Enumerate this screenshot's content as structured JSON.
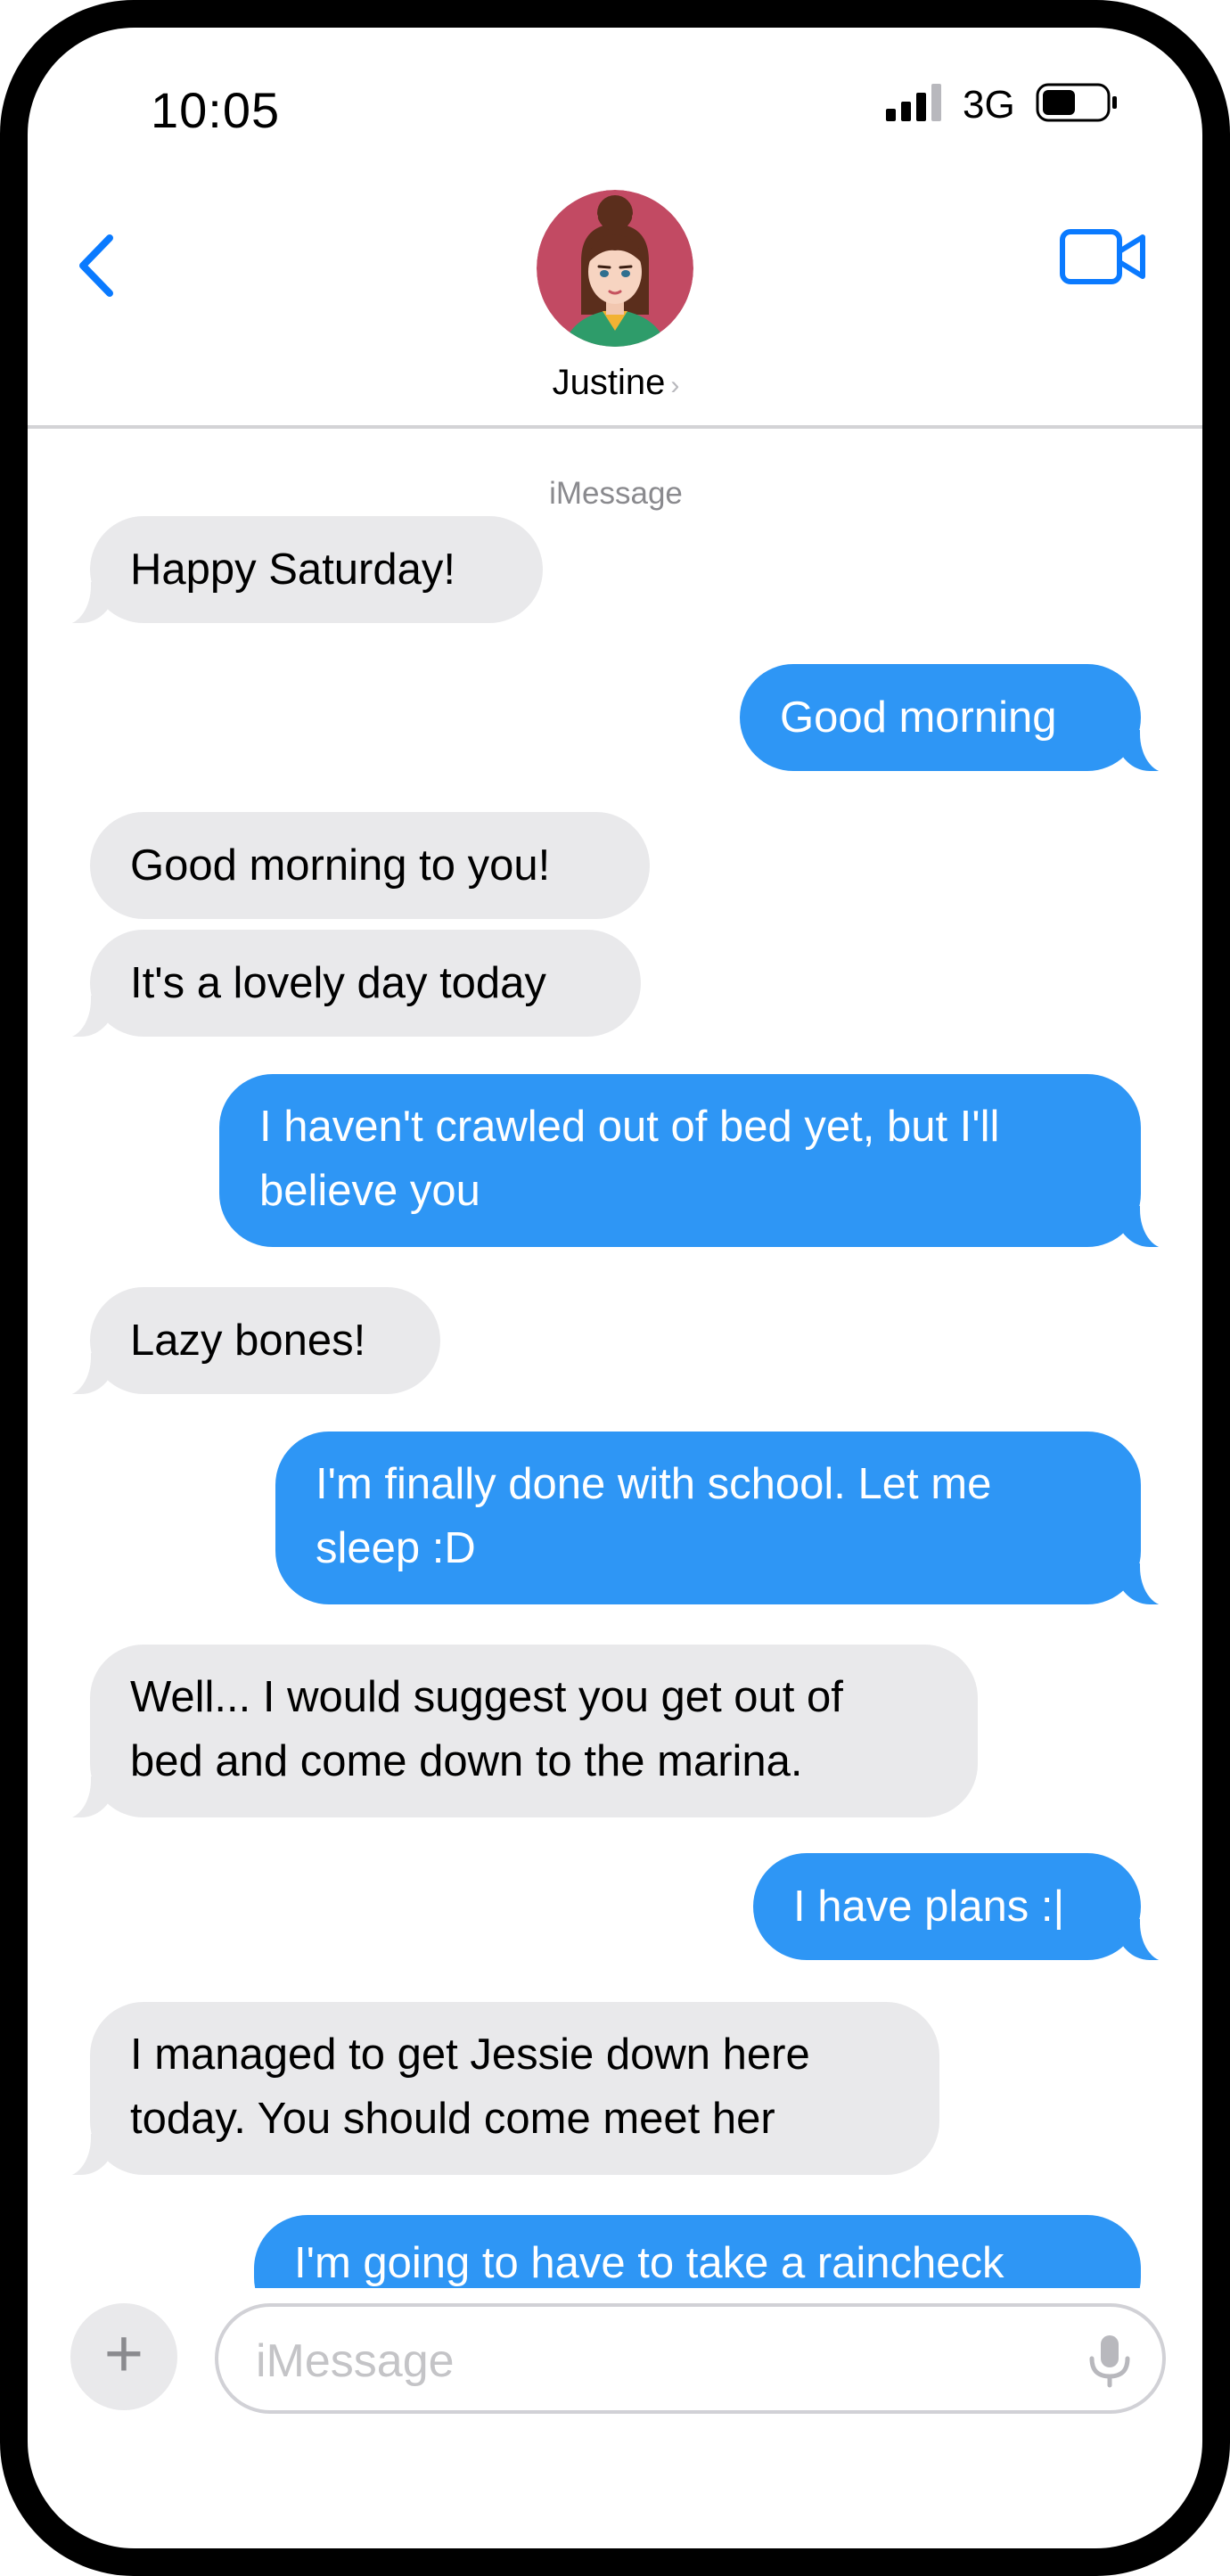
{
  "status_bar": {
    "time": "10:05",
    "network": "3G"
  },
  "header": {
    "contact_name": "Justine",
    "avatar_icon": "contact-avatar-icon",
    "back_icon": "chevron-left-icon",
    "video_icon": "video-camera-icon"
  },
  "conversation": {
    "service_label": "iMessage",
    "messages": [
      {
        "direction": "received",
        "text": "Happy Saturday!"
      },
      {
        "direction": "sent",
        "text": "Good morning"
      },
      {
        "direction": "received",
        "text": "Good morning to you!"
      },
      {
        "direction": "received",
        "text": "It's a lovely day today"
      },
      {
        "direction": "sent",
        "text": "I haven't crawled out of bed yet, but I'll\nbelieve you"
      },
      {
        "direction": "received",
        "text": "Lazy bones!"
      },
      {
        "direction": "sent",
        "text": "I'm finally done with school.  Let me\nsleep :D"
      },
      {
        "direction": "received",
        "text": "Well... I would suggest you get out of\nbed and come down to the marina."
      },
      {
        "direction": "sent",
        "text": "I have plans :|"
      },
      {
        "direction": "received",
        "text": "I managed to get Jessie down here\ntoday.  You should come meet her"
      },
      {
        "direction": "sent",
        "text": "I'm going to have to take a raincheck"
      }
    ]
  },
  "composer": {
    "placeholder": "iMessage",
    "value": "",
    "add_icon": "plus-icon",
    "mic_icon": "microphone-icon"
  },
  "colors": {
    "sent_bubble": "#2e96f5",
    "received_bubble": "#e9e9eb",
    "accent": "#0a7aff"
  }
}
